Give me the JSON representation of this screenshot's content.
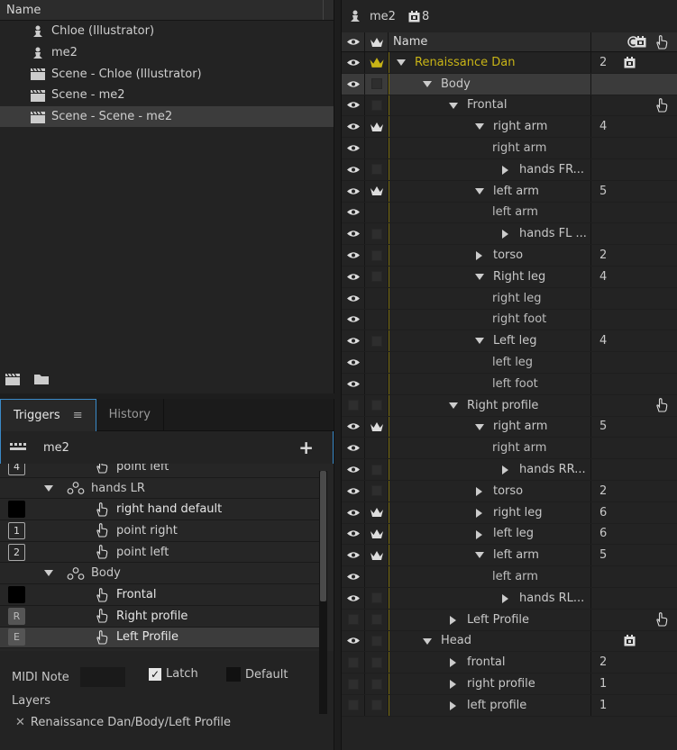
{
  "project": {
    "header": "Name",
    "items": [
      {
        "type": "puppet",
        "label": "Chloe (Illustrator)"
      },
      {
        "type": "puppet",
        "label": "me2"
      },
      {
        "type": "scene",
        "label": "Scene - Chloe (Illustrator)"
      },
      {
        "type": "scene",
        "label": "Scene - me2"
      },
      {
        "type": "scene",
        "label": "Scene - Scene - me2",
        "selected": true
      }
    ]
  },
  "triggers_panel": {
    "tabs": [
      {
        "label": "Triggers"
      },
      {
        "label": "History"
      }
    ],
    "puppet_name": "me2",
    "rows": [
      {
        "key": "4",
        "label": "point left",
        "kind": "trigger"
      },
      {
        "key": "",
        "label": "hands LR",
        "kind": "swapset"
      },
      {
        "key": "",
        "label": "right hand default",
        "kind": "trigger"
      },
      {
        "key": "1",
        "label": "point right",
        "kind": "trigger"
      },
      {
        "key": "2",
        "label": "point left",
        "kind": "trigger"
      },
      {
        "key": "",
        "label": "Body",
        "kind": "swapset"
      },
      {
        "key": "",
        "label": "Frontal",
        "kind": "trigger"
      },
      {
        "key": "R",
        "label": "Right profile",
        "kind": "trigger"
      },
      {
        "key": "E",
        "label": "Left Profile",
        "kind": "trigger",
        "selected": true
      }
    ],
    "midi_note_label": "MIDI Note",
    "midi_note_value": "",
    "latch_label": "Latch",
    "latch_checked": true,
    "default_label": "Default",
    "default_checked": false,
    "layers_label": "Layers",
    "layer_path": "Renaissance Dan/Body/Left Profile"
  },
  "puppet_panel": {
    "puppet_name": "me2",
    "count": "8",
    "col_name": "Name",
    "rows": [
      {
        "eye": true,
        "crown": "gold",
        "depth": 0,
        "expander": "down",
        "label": "Renaissance Dan",
        "num": "2",
        "lock": true,
        "hand": false,
        "gold": true
      },
      {
        "eye": true,
        "crown": "box",
        "depth": 1,
        "expander": "down",
        "label": "Body",
        "num": "",
        "lock": false,
        "hand": false,
        "selected": true
      },
      {
        "eye": true,
        "crown": "box",
        "depth": 2,
        "expander": "down",
        "label": "Frontal",
        "num": "",
        "lock": false,
        "hand": true
      },
      {
        "eye": true,
        "crown": "white",
        "depth": 3,
        "expander": "down",
        "label": "right arm",
        "num": "4",
        "lock": false,
        "hand": false
      },
      {
        "eye": true,
        "crown": "none",
        "depth": 4,
        "expander": "none",
        "label": "right arm",
        "num": "",
        "lock": false,
        "hand": false
      },
      {
        "eye": true,
        "crown": "box",
        "depth": 4,
        "expander": "right",
        "label": "hands FR...",
        "num": "",
        "lock": false,
        "hand": false
      },
      {
        "eye": true,
        "crown": "white",
        "depth": 3,
        "expander": "down",
        "label": "left arm",
        "num": "5",
        "lock": false,
        "hand": false
      },
      {
        "eye": true,
        "crown": "none",
        "depth": 4,
        "expander": "none",
        "label": "left arm",
        "num": "",
        "lock": false,
        "hand": false
      },
      {
        "eye": true,
        "crown": "box",
        "depth": 4,
        "expander": "right",
        "label": "hands FL ...",
        "num": "",
        "lock": false,
        "hand": false
      },
      {
        "eye": true,
        "crown": "box",
        "depth": 3,
        "expander": "right",
        "label": "torso",
        "num": "2",
        "lock": false,
        "hand": false
      },
      {
        "eye": true,
        "crown": "box",
        "depth": 3,
        "expander": "down",
        "label": "Right leg",
        "num": "4",
        "lock": false,
        "hand": false
      },
      {
        "eye": true,
        "crown": "none",
        "depth": 4,
        "expander": "none",
        "label": "right leg",
        "num": "",
        "lock": false,
        "hand": false
      },
      {
        "eye": true,
        "crown": "none",
        "depth": 4,
        "expander": "none",
        "label": "right foot",
        "num": "",
        "lock": false,
        "hand": false
      },
      {
        "eye": true,
        "crown": "box",
        "depth": 3,
        "expander": "down",
        "label": "Left leg",
        "num": "4",
        "lock": false,
        "hand": false
      },
      {
        "eye": true,
        "crown": "none",
        "depth": 4,
        "expander": "none",
        "label": "left leg",
        "num": "",
        "lock": false,
        "hand": false
      },
      {
        "eye": true,
        "crown": "none",
        "depth": 4,
        "expander": "none",
        "label": "left foot",
        "num": "",
        "lock": false,
        "hand": false
      },
      {
        "eye": false,
        "crown": "box",
        "depth": 2,
        "expander": "down",
        "label": "Right profile",
        "num": "",
        "lock": false,
        "hand": true
      },
      {
        "eye": true,
        "crown": "white",
        "depth": 3,
        "expander": "down",
        "label": "right arm",
        "num": "5",
        "lock": false,
        "hand": false
      },
      {
        "eye": true,
        "crown": "none",
        "depth": 4,
        "expander": "none",
        "label": "right arm",
        "num": "",
        "lock": false,
        "hand": false
      },
      {
        "eye": true,
        "crown": "box",
        "depth": 4,
        "expander": "right",
        "label": "hands RR...",
        "num": "",
        "lock": false,
        "hand": false
      },
      {
        "eye": true,
        "crown": "box",
        "depth": 3,
        "expander": "right",
        "label": "torso",
        "num": "2",
        "lock": false,
        "hand": false
      },
      {
        "eye": true,
        "crown": "white",
        "depth": 3,
        "expander": "right",
        "label": "right leg",
        "num": "6",
        "lock": false,
        "hand": false
      },
      {
        "eye": true,
        "crown": "white",
        "depth": 3,
        "expander": "right",
        "label": "left leg",
        "num": "6",
        "lock": false,
        "hand": false
      },
      {
        "eye": true,
        "crown": "white",
        "depth": 3,
        "expander": "down",
        "label": "left arm",
        "num": "5",
        "lock": false,
        "hand": false
      },
      {
        "eye": true,
        "crown": "none",
        "depth": 4,
        "expander": "none",
        "label": "left arm",
        "num": "",
        "lock": false,
        "hand": false
      },
      {
        "eye": true,
        "crown": "box",
        "depth": 4,
        "expander": "right",
        "label": "hands RL...",
        "num": "",
        "lock": false,
        "hand": false
      },
      {
        "eye": false,
        "crown": "box",
        "depth": 2,
        "expander": "right",
        "label": "Left Profile",
        "num": "",
        "lock": false,
        "hand": true
      },
      {
        "eye": true,
        "crown": "box",
        "depth": 1,
        "expander": "down",
        "label": "Head",
        "num": "",
        "lock": true,
        "hand": false
      },
      {
        "eye": false,
        "crown": "box",
        "depth": 2,
        "expander": "right",
        "label": "frontal",
        "num": "2",
        "lock": false,
        "hand": false
      },
      {
        "eye": false,
        "crown": "box",
        "depth": 2,
        "expander": "right",
        "label": "right profile",
        "num": "1",
        "lock": false,
        "hand": false
      },
      {
        "eye": false,
        "crown": "box",
        "depth": 2,
        "expander": "right",
        "label": "left profile",
        "num": "1",
        "lock": false,
        "hand": false
      }
    ]
  },
  "colors": {
    "accent": "#3a8ac8",
    "gold": "#c8b416",
    "panel": "#232323"
  }
}
